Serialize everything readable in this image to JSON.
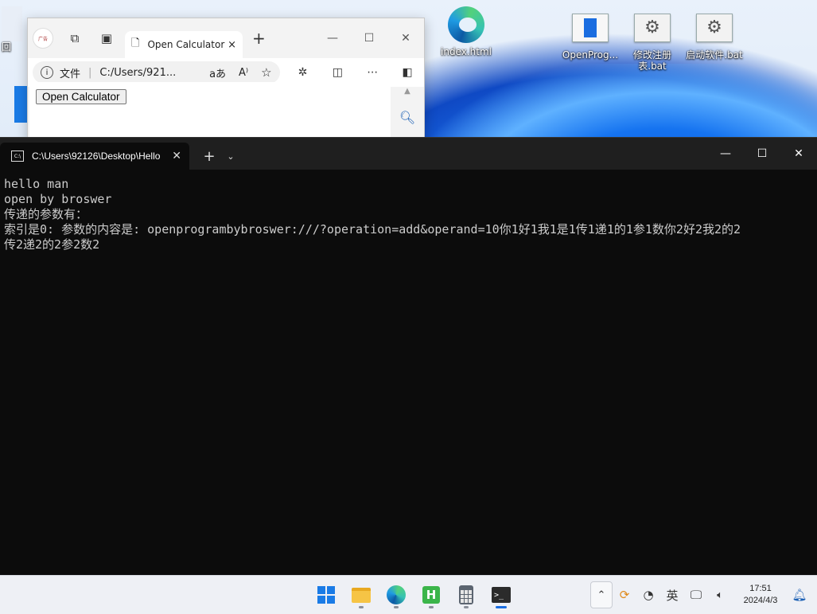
{
  "desktop": {
    "icons": [
      {
        "label": "index.html"
      },
      {
        "label": "OpenProg..."
      },
      {
        "label": "修改注册表.bat"
      },
      {
        "label": "启动软件.bat"
      }
    ],
    "edge_partial_label": "回"
  },
  "browser": {
    "tab_title": "Open Calculator",
    "tab_close": "×",
    "new_tab": "+",
    "address_prefix": "文件",
    "address_text": "C:/Users/921...",
    "read_aloud_glyph": "aあ",
    "content_button": "Open Calculator",
    "controls": {
      "minimize": "—",
      "maximize": "☐",
      "close": "✕"
    }
  },
  "terminal": {
    "tab_title": "C:\\Users\\92126\\Desktop\\Hello",
    "tab_icon_text": "C:\\",
    "tab_close": "✕",
    "new_tab": "+",
    "dropdown": "⌄",
    "controls": {
      "minimize": "—",
      "maximize": "☐",
      "close": "✕"
    },
    "output": "hello man\nopen by broswer\n传递的参数有：\n索引是0: 参数的内容是: openprogrambybroswer:///?operation=add&operand=10你1好1我1是1传1递1的1参1数你2好2我2的2\n传2递2的2参2数2"
  },
  "taskbar": {
    "ime": "英",
    "time": "17:51",
    "date": "2024/4/3",
    "hbuilder_letter": "H",
    "terminal_glyph": ">_"
  }
}
